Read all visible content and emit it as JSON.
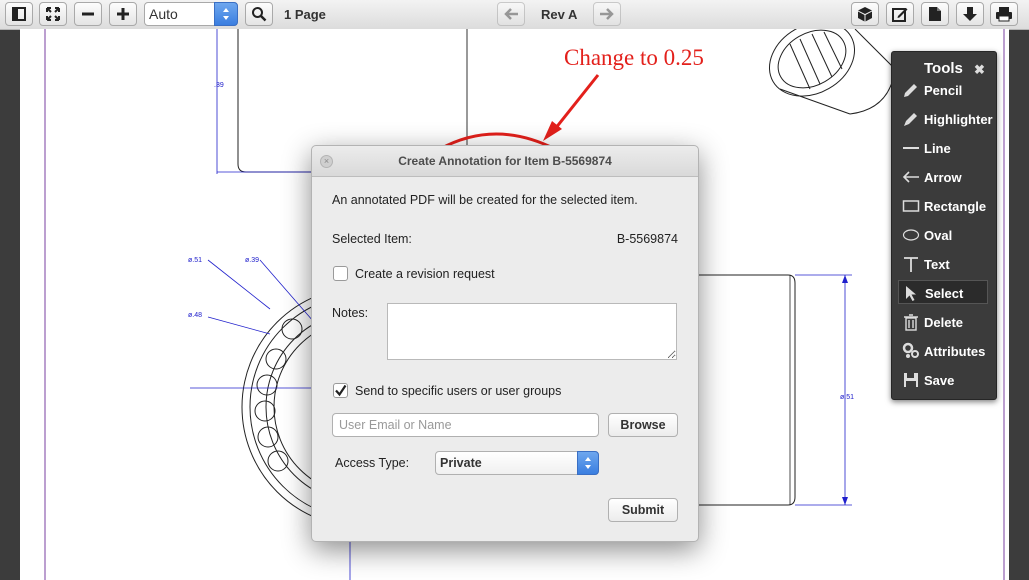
{
  "toolbar": {
    "zoom_value": "Auto",
    "page_count": "1 Page",
    "revision": "Rev A",
    "icons": [
      "sidebar-toggle-icon",
      "fit-page-icon",
      "zoom-out-icon",
      "zoom-in-icon",
      "search-icon",
      "prev-revision-icon",
      "next-revision-icon",
      "3d-model-icon",
      "annotate-icon",
      "document-icon",
      "download-icon",
      "print-icon"
    ]
  },
  "drawing": {
    "dimensions": {
      "d1": ".39",
      "d2": "ø.51",
      "d3": "ø.39",
      "d4": "ø.48",
      "d5": "ø.51"
    }
  },
  "annotation": {
    "text": "Change to 0.25",
    "color": "#e3201b"
  },
  "tools_panel": {
    "title": "Tools",
    "close_glyph": "✖",
    "items": [
      {
        "label": "Pencil",
        "icon": "pencil-icon"
      },
      {
        "label": "Highlighter",
        "icon": "highlighter-icon"
      },
      {
        "label": "Line",
        "icon": "line-icon"
      },
      {
        "label": "Arrow",
        "icon": "arrow-icon"
      },
      {
        "label": "Rectangle",
        "icon": "rectangle-icon"
      },
      {
        "label": "Oval",
        "icon": "oval-icon"
      },
      {
        "label": "Text",
        "icon": "text-icon"
      },
      {
        "label": "Select",
        "icon": "select-cursor-icon"
      },
      {
        "label": "Delete",
        "icon": "trash-icon"
      },
      {
        "label": "Attributes",
        "icon": "gears-icon"
      },
      {
        "label": "Save",
        "icon": "save-icon"
      }
    ],
    "selected": "Select"
  },
  "dialog": {
    "title": "Create Annotation for Item B-5569874",
    "description": "An annotated PDF will be created for the selected item.",
    "selected_item_label": "Selected Item:",
    "selected_item_value": "B-5569874",
    "revision_request_label": "Create a revision request",
    "revision_request_checked": false,
    "notes_label": "Notes:",
    "notes_value": "",
    "send_to_label": "Send to specific users or user groups",
    "send_to_checked": true,
    "user_field_placeholder": "User Email or Name",
    "browse_label": "Browse",
    "access_type_label": "Access Type:",
    "access_type_value": "Private",
    "submit_label": "Submit"
  }
}
